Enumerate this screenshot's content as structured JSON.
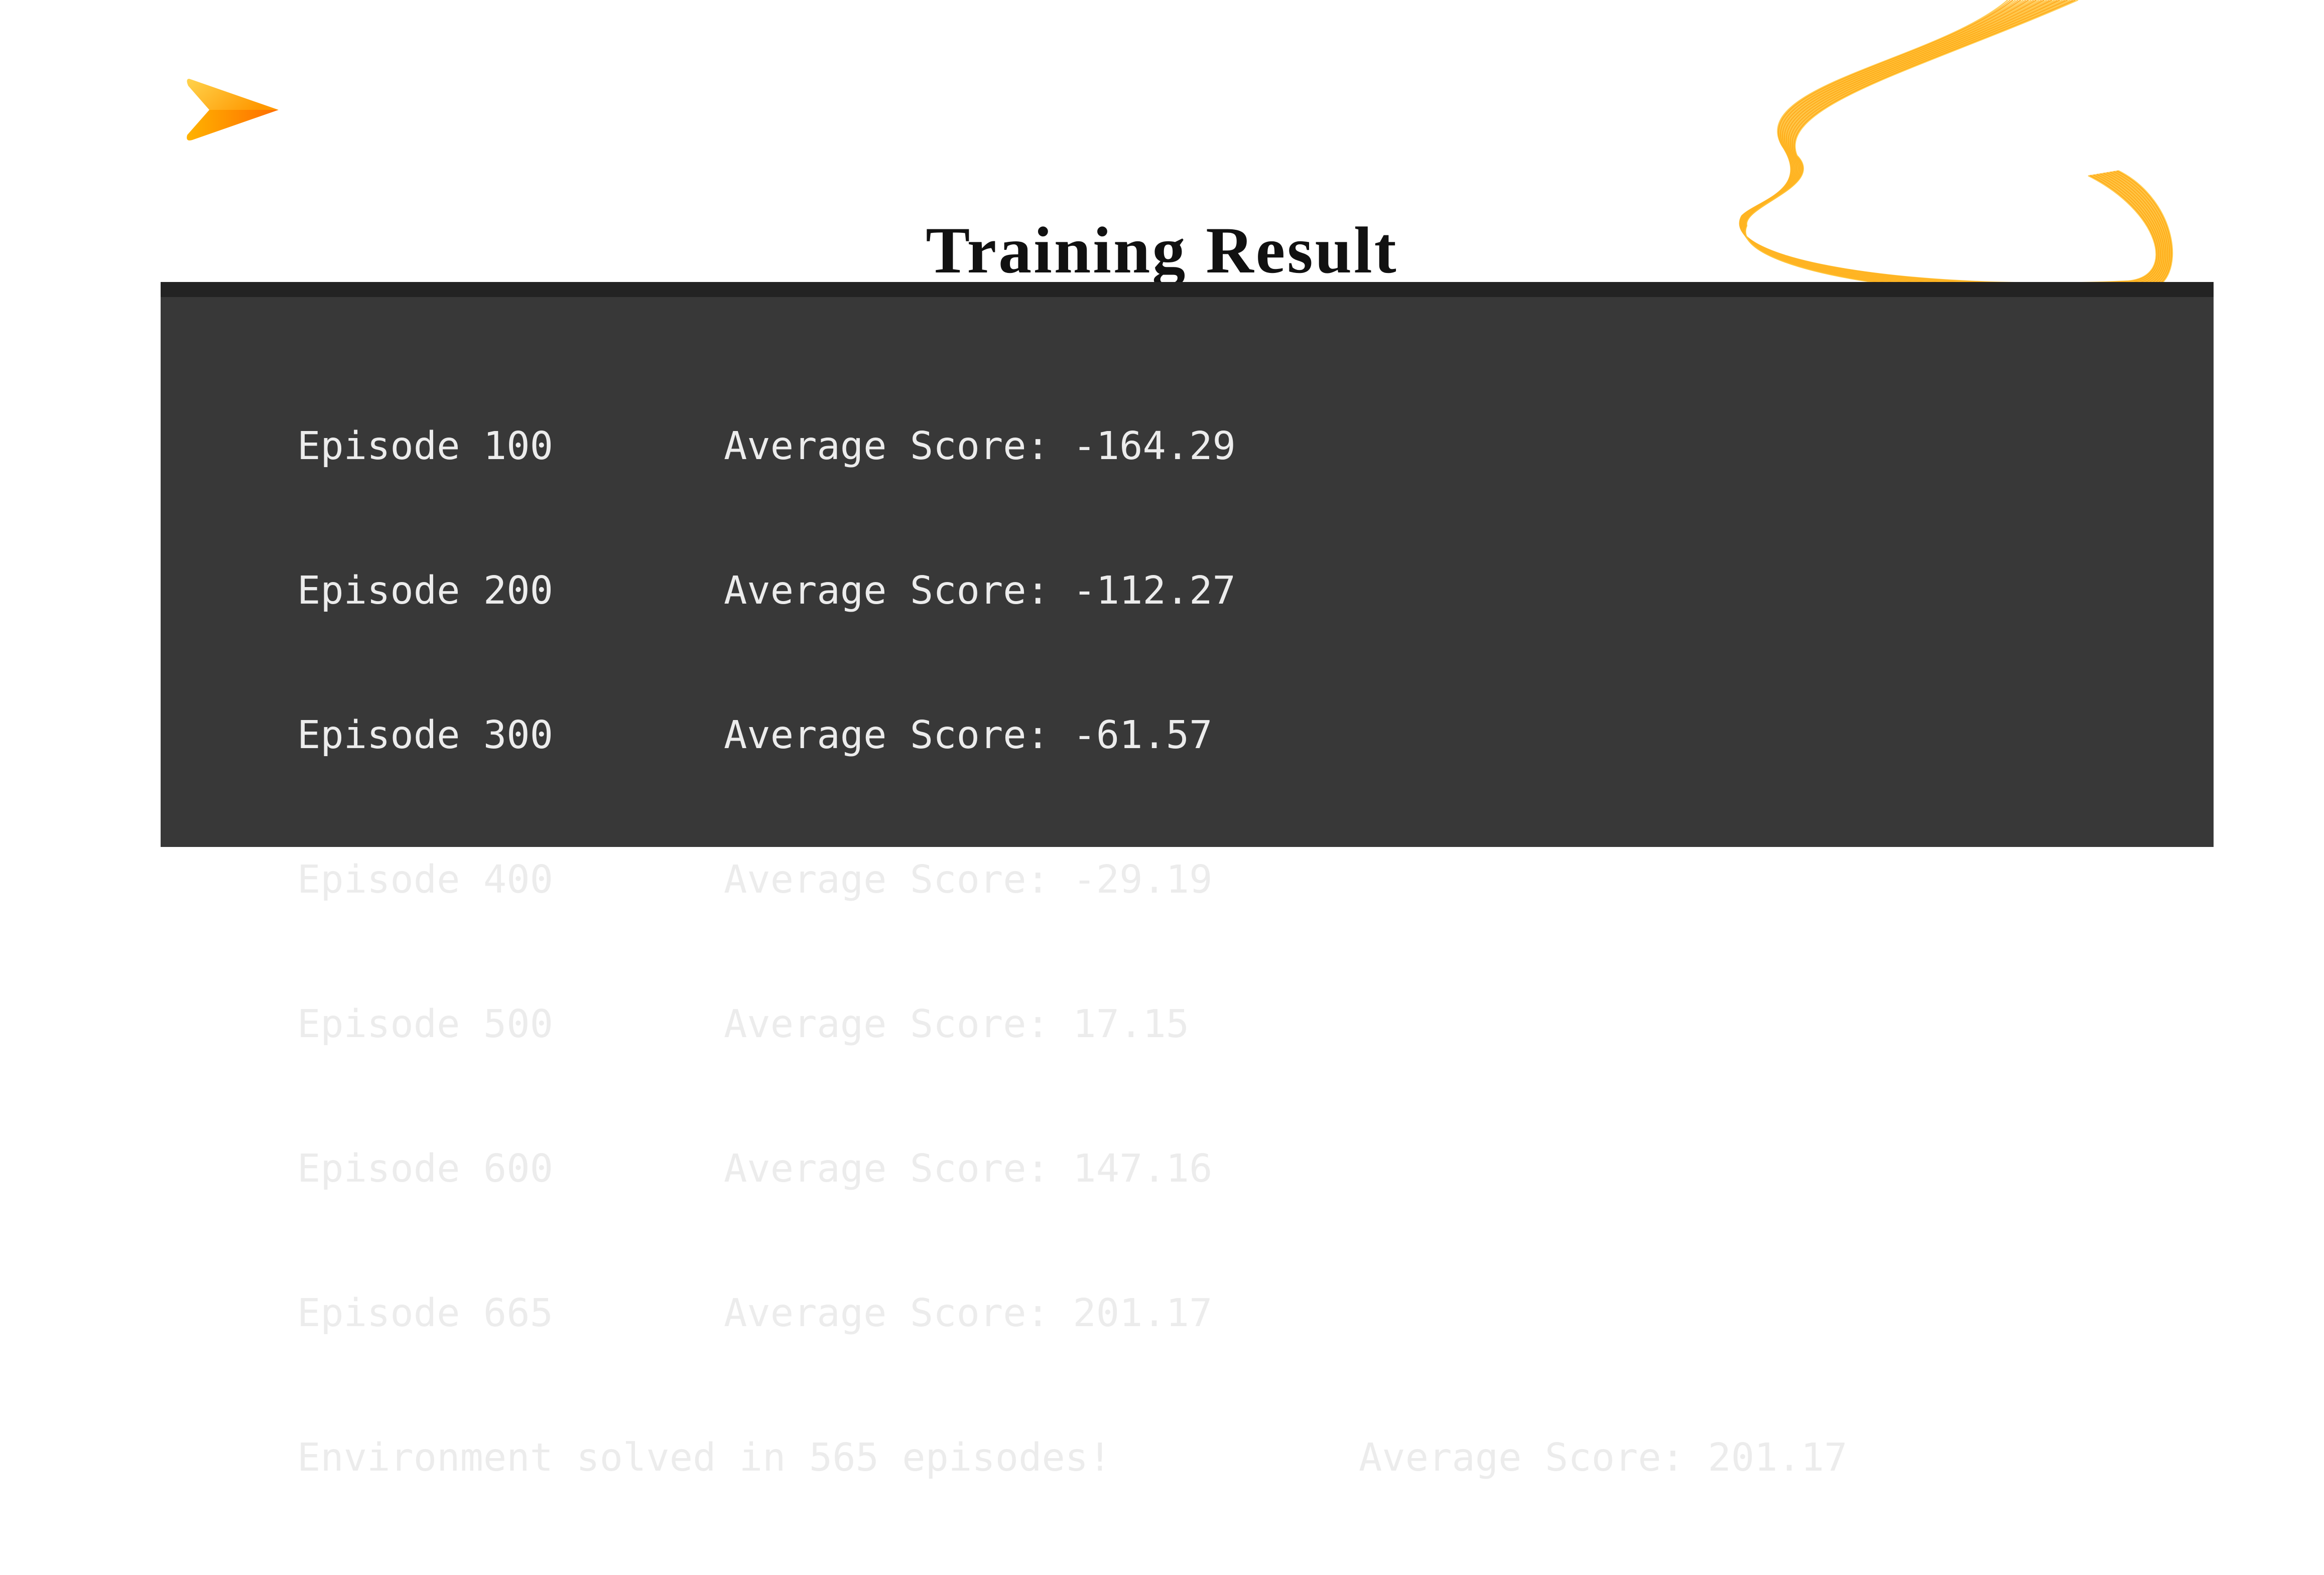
{
  "slide": {
    "title": "Training Result",
    "accent_colors": [
      "#FFC83D",
      "#FFA000",
      "#FF7A00"
    ]
  },
  "logo": {
    "icon": "play-arrow-logo-icon"
  },
  "decoration": {
    "icon": "orange-wave-lines-icon"
  },
  "terminal": {
    "background": "#383838",
    "text_color": "#ECECEC",
    "episodes": [
      {
        "episode": "Episode 100",
        "score": "Average Score: -164.29"
      },
      {
        "episode": "Episode 200",
        "score": "Average Score: -112.27"
      },
      {
        "episode": "Episode 300",
        "score": "Average Score: -61.57"
      },
      {
        "episode": "Episode 400",
        "score": "Average Score: -29.19"
      },
      {
        "episode": "Episode 500",
        "score": "Average Score: 17.15"
      },
      {
        "episode": "Episode 600",
        "score": "Average Score: 147.16"
      },
      {
        "episode": "Episode 665",
        "score": "Average Score: 201.17"
      }
    ],
    "final": {
      "message": "Environment solved in 565 episodes!",
      "score": "Average Score: 201.17"
    }
  }
}
